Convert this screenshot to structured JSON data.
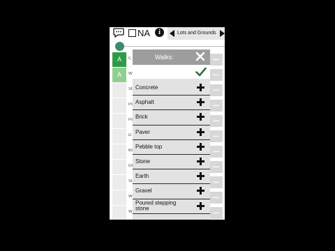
{
  "toolbar": {
    "na_label": "NA",
    "info_glyph": "i",
    "section_title": "Lots and Grounds",
    "icons": [
      "chat-icon",
      "info-icon",
      "chevron-left-icon",
      "chevron-right-icon"
    ]
  },
  "slider": {
    "value": 0
  },
  "background_rows": [
    {
      "answer": "A",
      "text": "C",
      "style": "g1"
    },
    {
      "answer": "A",
      "text": "W",
      "style": "g2"
    },
    {
      "answer": "",
      "text": "St",
      "style": ""
    },
    {
      "answer": "",
      "text": "Po",
      "style": ""
    },
    {
      "answer": "",
      "text": "Pa",
      "style": ""
    },
    {
      "answer": "",
      "text": "D",
      "style": ""
    },
    {
      "answer": "",
      "text": "Ba",
      "style": ""
    },
    {
      "answer": "",
      "text": "Gr",
      "style": ""
    },
    {
      "answer": "",
      "text": "Su",
      "style": ""
    },
    {
      "answer": "",
      "text": "W",
      "style": ""
    },
    {
      "answer": "",
      "text": "W",
      "style": ""
    }
  ],
  "modal": {
    "title": "Walks:",
    "current_value": "",
    "options": [
      "Concrete",
      "Asphalt",
      "Brick",
      "Paver",
      "Pebble top",
      "Stone",
      "Earth",
      "Gravel",
      "Poured stepping stone"
    ]
  },
  "colors": {
    "accent_green": "#2e9b46",
    "light_green": "#8fcf92",
    "check_green": "#2f6e3b",
    "modal_header": "#9d9d9d",
    "slider_knob": "#3e8a6e"
  }
}
